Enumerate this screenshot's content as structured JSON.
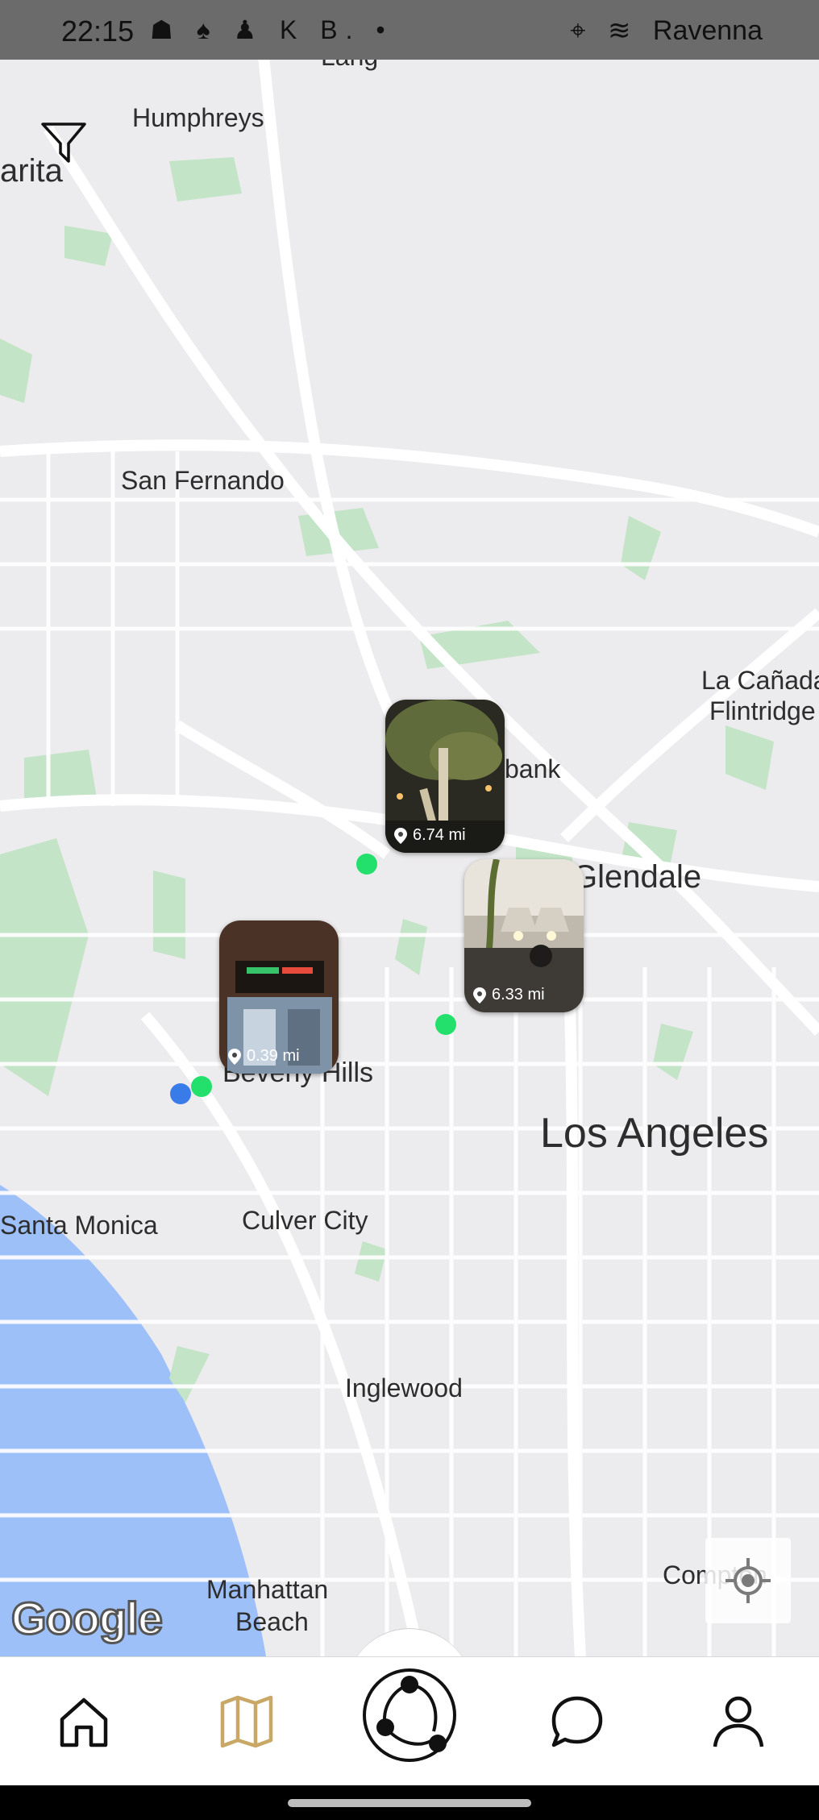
{
  "status_bar": {
    "time": "22:15",
    "left_icons": "☗ ♠ ♟ K B. •",
    "right_text": "Ravenna"
  },
  "map": {
    "labels": {
      "lang": "Lang",
      "humphreys": "Humphreys",
      "arita": "arita",
      "san_fernando": "San Fernando",
      "la_canada": "La Cañada",
      "flintridge": "Flintridge",
      "burbank": "bank",
      "glendale": "Glendale",
      "beverly_hills": "Beverly Hills",
      "los_angeles": "Los Angeles",
      "santa_monica": "Santa Monica",
      "culver_city": "Culver City",
      "inglewood": "Inglewood",
      "manhattan": "Manhattan",
      "beach": "Beach",
      "compton": "Compton"
    },
    "places": [
      {
        "distance": "6.74 mi"
      },
      {
        "distance": "6.33 mi"
      },
      {
        "distance": "0.39 mi"
      }
    ],
    "google_logo": "Google",
    "filter_icon": "filter-icon",
    "locate_icon": "my-location-icon"
  },
  "nav": {
    "items": [
      "home-icon",
      "map-icon",
      "connect-icon",
      "chat-icon",
      "profile-icon"
    ],
    "active": "map-icon",
    "active_color": "#c9a867"
  },
  "colors": {
    "marker": "#22e06b",
    "user_marker": "#3a7bea",
    "water": "#9dc0f8",
    "park": "#c3e4c6"
  }
}
